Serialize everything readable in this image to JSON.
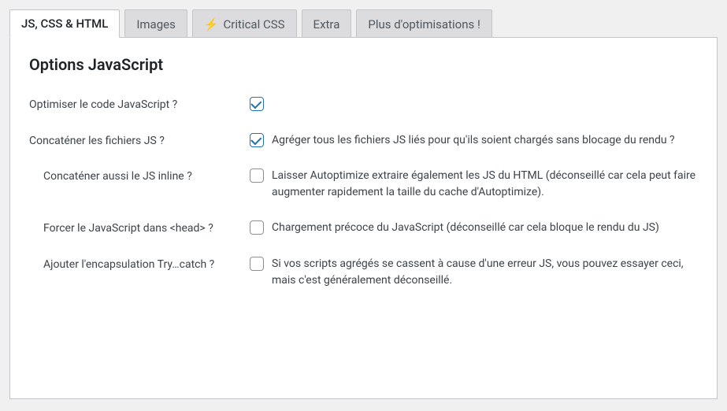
{
  "tabs": {
    "t0": "JS, CSS & HTML",
    "t1": "Images",
    "t2": "Critical CSS",
    "t3": "Extra",
    "t4": "Plus d'optimisations !"
  },
  "heading": "Options JavaScript",
  "rows": {
    "optimize": {
      "label": "Optimiser le code JavaScript ?",
      "checked": true,
      "desc": ""
    },
    "concat": {
      "label": "Concaténer les fichiers JS ?",
      "checked": true,
      "desc": "Agréger tous les fichiers JS liés pour qu'ils soient chargés sans blocage du rendu ?"
    },
    "inline": {
      "label": "Concaténer aussi le JS inline ?",
      "checked": false,
      "desc": "Laisser Autoptimize extraire également les JS du HTML (déconseillé car cela peut faire augmenter rapidement la taille du cache d'Autoptimize)."
    },
    "head": {
      "label": "Forcer le JavaScript dans <head> ?",
      "checked": false,
      "desc": "Chargement précoce du JavaScript (déconseillé car cela bloque le rendu du JS)"
    },
    "trycatch": {
      "label": "Ajouter l'encapsulation Try…catch ?",
      "checked": false,
      "desc": "Si vos scripts agrégés se cassent à cause d'une erreur JS, vous pouvez essayer ceci, mais c'est généralement déconseillé."
    }
  }
}
